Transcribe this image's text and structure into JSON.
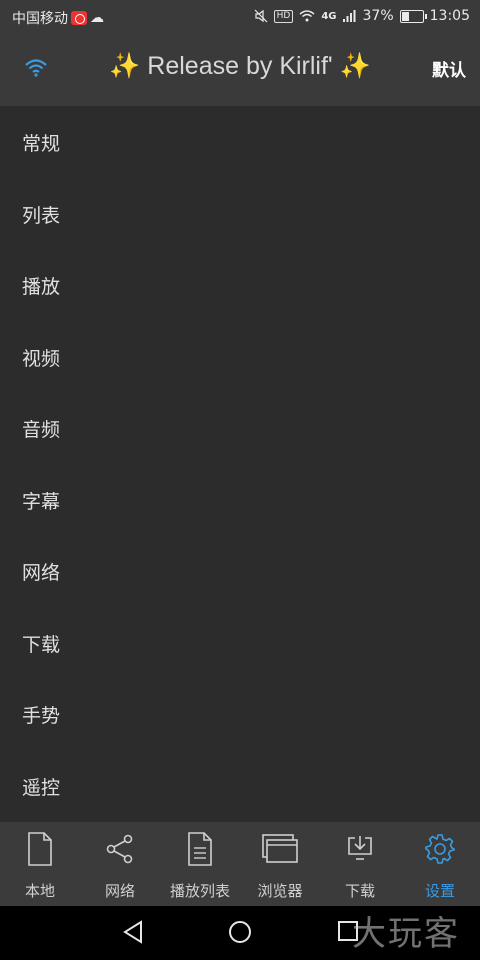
{
  "status": {
    "carrier": "中国移动",
    "network": "4G",
    "battery": "37%",
    "battery_level": 0.37,
    "time": "13:05"
  },
  "appbar": {
    "sparkle": "✨",
    "title": "Release by Kirlif'",
    "action_label": "默认"
  },
  "settings": {
    "items": [
      {
        "label": "常规"
      },
      {
        "label": "列表"
      },
      {
        "label": "播放"
      },
      {
        "label": "视频"
      },
      {
        "label": "音频"
      },
      {
        "label": "字幕"
      },
      {
        "label": "网络"
      },
      {
        "label": "下载"
      },
      {
        "label": "手势"
      },
      {
        "label": "遥控"
      }
    ]
  },
  "bottom_nav": {
    "tabs": [
      {
        "label": "本地",
        "icon": "file-icon"
      },
      {
        "label": "网络",
        "icon": "share-icon"
      },
      {
        "label": "播放列表",
        "icon": "document-list-icon"
      },
      {
        "label": "浏览器",
        "icon": "browser-window-icon"
      },
      {
        "label": "下载",
        "icon": "download-tray-icon"
      },
      {
        "label": "设置",
        "icon": "gear-icon",
        "active": true
      }
    ]
  },
  "watermark": "大玩客",
  "colors": {
    "background": "#2c2c2c",
    "bar": "#3a3a3a",
    "accent": "#3a9be0",
    "sparkle": "#f5c518"
  }
}
